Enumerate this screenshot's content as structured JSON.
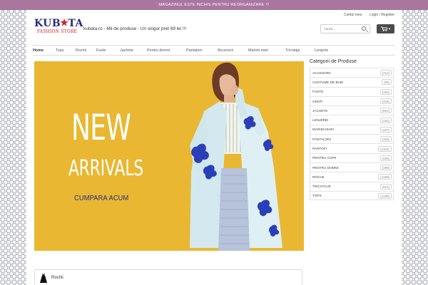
{
  "announcement": "MAGAZINUL ESTE INCHIS PENTRU REORGANIZARE !!!",
  "logo": {
    "main_left": "KUB",
    "main_right": "TA",
    "sub": "FASHION STORE"
  },
  "tagline": "kubata.ro - Mii de produse - Un singur pret 69 lei !!!",
  "top_links": {
    "account": "Contul meu",
    "login": "Login / Register"
  },
  "search": {
    "placeholder": "cauta..."
  },
  "nav": [
    "Home",
    "Tops",
    "Rochii",
    "Fuste",
    "Jachete",
    "Pentru domni",
    "Pantaloni",
    "Accesorii",
    "Marimi mari",
    "Tricotaje",
    "Lenjerie"
  ],
  "hero": {
    "line1": "NEW",
    "line2": "ARRIVALS",
    "cta": "CUMPARA ACUM"
  },
  "sidebar": {
    "title": "Categorii de Produse",
    "items": [
      {
        "label": "ACCESORII",
        "count": "(212)"
      },
      {
        "label": "COSTUME DE BAIE",
        "count": "(58)"
      },
      {
        "label": "FUSTE",
        "count": "(262)"
      },
      {
        "label": "GENTI",
        "count": "(234)"
      },
      {
        "label": "JACHETE",
        "count": "(822)"
      },
      {
        "label": "LENJERIE",
        "count": "(162)"
      },
      {
        "label": "MARIMI MARI",
        "count": "(447)"
      },
      {
        "label": "PANTALONI",
        "count": "(325)"
      },
      {
        "label": "PANTOFI",
        "count": "(1341)"
      },
      {
        "label": "PENTRU COPII",
        "count": "(226)"
      },
      {
        "label": "PENTRU DOMNI",
        "count": "(289)"
      },
      {
        "label": "ROCHII",
        "count": "(1328)"
      },
      {
        "label": "TRICOTAJE",
        "count": "(814)"
      },
      {
        "label": "TOPS",
        "count": "(1239)"
      }
    ]
  },
  "bottom_section": {
    "label": "Rochii"
  },
  "colors": {
    "announcement_bg": "#a8769f",
    "hero_bg": "#e9b732",
    "cta_text": "#1f2f86",
    "logo_blue": "#2b2b7a",
    "logo_red": "#d0202a"
  }
}
